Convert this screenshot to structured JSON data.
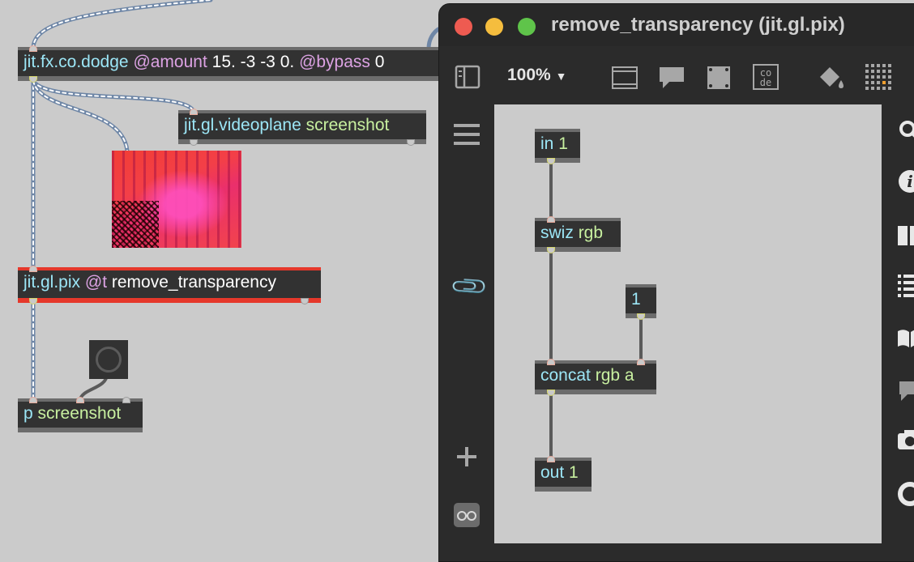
{
  "parent_patch": {
    "dodge": {
      "cls": "jit.fx.co.dodge",
      "a1": "@amount",
      "v1": "15. -3 -3 0.",
      "a2": "@bypass",
      "v2": "0"
    },
    "videoplane": {
      "cls": "jit.gl.videoplane",
      "arg": "screenshot"
    },
    "pix": {
      "cls": "jit.gl.pix",
      "a1": "@t",
      "v1": "remove_transparency"
    },
    "screenshot": {
      "cls": "p",
      "arg": "screenshot"
    }
  },
  "window": {
    "title": "remove_transparency (jit.gl.pix)",
    "zoom": "100%",
    "code_icon_text": "co de",
    "traffic_lights": {
      "close": "#ee5b51",
      "minimize": "#f5bd3e",
      "zoom": "#5fc44a"
    }
  },
  "sub_patch": {
    "in": {
      "cls": "in",
      "arg": "1"
    },
    "swiz": {
      "cls": "swiz",
      "arg": "rgb"
    },
    "const": {
      "value": "1"
    },
    "concat": {
      "cls": "concat",
      "arg": "rgb a"
    },
    "out": {
      "cls": "out",
      "arg": "1"
    }
  },
  "colors": {
    "canvas": "#cbcbcb",
    "object": "#323232",
    "selected_border": "#e5382b",
    "class_text": "#9ce6f6",
    "attr_text": "#dca2e3"
  }
}
